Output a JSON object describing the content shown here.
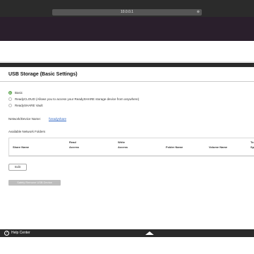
{
  "browser": {
    "url": "10.0.0.1",
    "close_glyph": "⊗"
  },
  "page": {
    "title": "USB Storage (Basic Settings)"
  },
  "access_options": [
    {
      "label": "Basic",
      "selected": true
    },
    {
      "label": "ReadyCLOUD (Allows you to access your ReadySHARE storage device from anywhere)",
      "selected": false
    },
    {
      "label": "ReadySHARE Vault",
      "selected": false
    }
  ],
  "device": {
    "label": "Network/Device Name:",
    "value": "\\\\readyshare"
  },
  "folders": {
    "label": "Available Network Folders",
    "columns": [
      {
        "line1": "Share Name",
        "line2": ""
      },
      {
        "line1": "Read",
        "line2": "Access"
      },
      {
        "line1": "Write",
        "line2": "Access"
      },
      {
        "line1": "Folder Name",
        "line2": ""
      },
      {
        "line1": "Volume Name",
        "line2": ""
      },
      {
        "line1": "To",
        "line2": "Sp"
      }
    ]
  },
  "buttons": {
    "edit": "Edit",
    "eject": "Safely Remove USB Device"
  },
  "footer": {
    "help_label": "Help Center",
    "help_glyph": "?"
  },
  "colors": {
    "accent_green": "#4a9b3a",
    "link_blue": "#2f66c4",
    "header_bg": "#2a1f2c"
  }
}
